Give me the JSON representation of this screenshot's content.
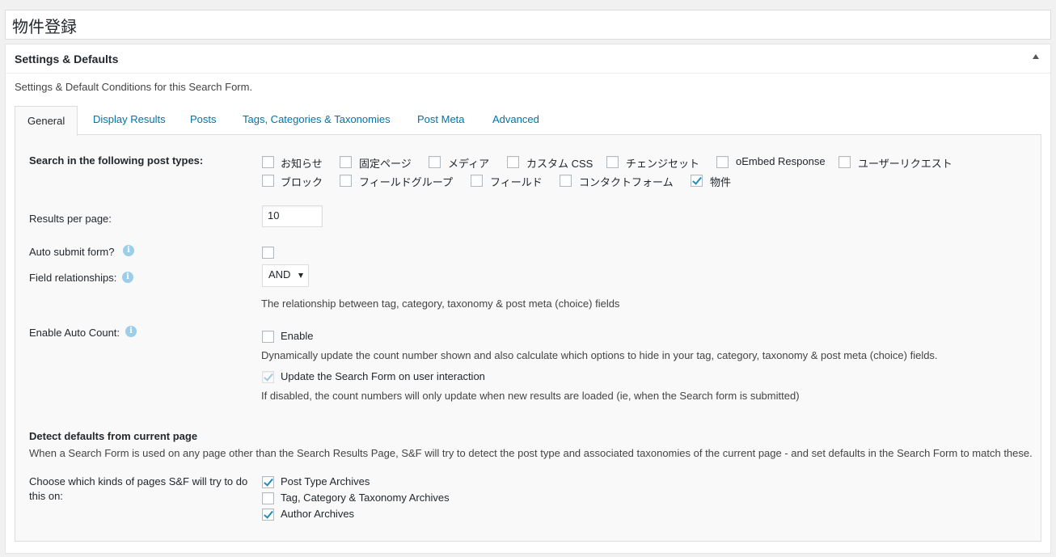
{
  "title": "物件登録",
  "metabox": {
    "title": "Settings & Defaults",
    "description": "Settings & Default Conditions for this Search Form."
  },
  "tabs": [
    {
      "label": "General",
      "active": true
    },
    {
      "label": "Display Results"
    },
    {
      "label": "Posts"
    },
    {
      "label": "Tags, Categories & Taxonomies"
    },
    {
      "label": "Post Meta"
    },
    {
      "label": "Advanced"
    }
  ],
  "general": {
    "post_types_label": "Search in the following post types:",
    "post_types": [
      {
        "label": "お知らせ",
        "checked": false
      },
      {
        "label": "固定ページ",
        "checked": false
      },
      {
        "label": "メディア",
        "checked": false
      },
      {
        "label": "カスタム CSS",
        "checked": false
      },
      {
        "label": "チェンジセット",
        "checked": false
      },
      {
        "label": "oEmbed Response",
        "checked": false
      },
      {
        "label": "ユーザーリクエスト",
        "checked": false
      },
      {
        "label": "ブロック",
        "checked": false
      },
      {
        "label": "フィールドグループ",
        "checked": false
      },
      {
        "label": "フィールド",
        "checked": false
      },
      {
        "label": "コンタクトフォーム",
        "checked": false
      },
      {
        "label": "物件",
        "checked": true
      }
    ],
    "results_per_page_label": "Results per page:",
    "results_per_page_value": "10",
    "auto_submit_label": "Auto submit form?",
    "field_relationships_label": "Field relationships:",
    "field_relationships_value": "AND",
    "field_relationships_desc": "The relationship between tag, category, taxonomy & post meta (choice) fields",
    "auto_count_label": "Enable Auto Count:",
    "auto_count_enable_label": "Enable",
    "auto_count_desc": "Dynamically update the count number shown and also calculate which options to hide in your tag, category, taxonomy & post meta (choice) fields.",
    "update_on_interaction_label": "Update the Search Form on user interaction",
    "update_on_interaction_desc": "If disabled, the count numbers will only update when new results are loaded (ie, when the Search form is submitted)",
    "detect_title": "Detect defaults from current page",
    "detect_desc": "When a Search Form is used on any page other than the Search Results Page, S&F will try to detect the post type and associated taxonomies of the current page - and set defaults in the Search Form to match these.",
    "detect_choose_label_1": "Choose which kinds of pages S&F will try to do",
    "detect_choose_label_2": "this on:",
    "detect_options": [
      {
        "label": "Post Type Archives",
        "checked": true
      },
      {
        "label": "Tag, Category & Taxonomy Archives",
        "checked": false
      },
      {
        "label": "Author Archives",
        "checked": true
      }
    ]
  },
  "colors": {
    "link": "#0073aa",
    "checkmark": "#1e8cbe",
    "help_icon": "#9ccde9"
  }
}
